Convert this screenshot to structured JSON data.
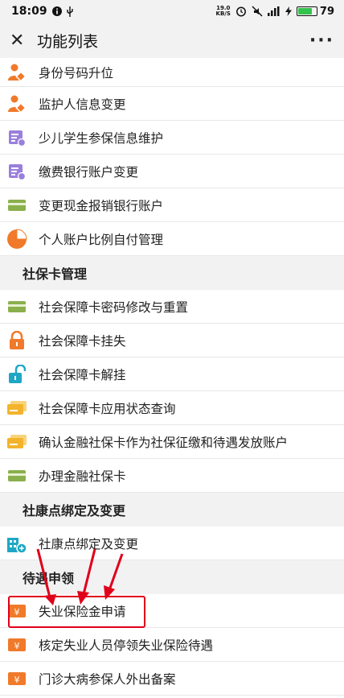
{
  "status_bar": {
    "time": "18:09",
    "net_speed_value": "19.0",
    "net_speed_unit": "KB/S",
    "battery": "79"
  },
  "header": {
    "title": "功能列表",
    "more": "···",
    "close": "✕"
  },
  "rows": {
    "r1": "身份号码升位",
    "r2": "监护人信息变更",
    "r3": "少儿学生参保信息维护",
    "r4": "缴费银行账户变更",
    "r5": "变更现金报销银行账户",
    "r6": "个人账户比例自付管理",
    "sec1": "社保卡管理",
    "r7": "社会保障卡密码修改与重置",
    "r8": "社会保障卡挂失",
    "r9": "社会保障卡解挂",
    "r10": "社会保障卡应用状态查询",
    "r11": "确认金融社保卡作为社保征缴和待遇发放账户",
    "r12": "办理金融社保卡",
    "sec2": "社康点绑定及变更",
    "r13": "社康点绑定及变更",
    "sec3": "待遇申领",
    "r14": "失业保险金申请",
    "r15": "核定失业人员停领失业保险待遇",
    "r16": "门诊大病参保人外出备案"
  },
  "colors": {
    "orange": "#f07a2a",
    "purple": "#9a7fdc",
    "green": "#8ab04c",
    "teal": "#1ea7c4",
    "yellow": "#f3b42c",
    "red_annotation": "#e0001a"
  }
}
